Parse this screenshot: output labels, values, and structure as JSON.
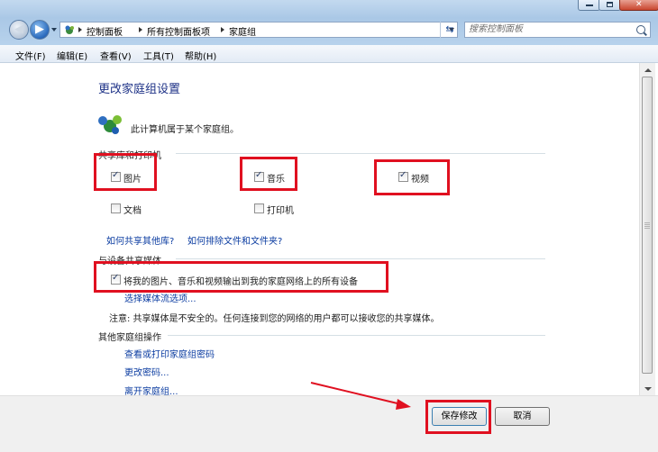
{
  "window": {
    "breadcrumb": [
      "控制面板",
      "所有控制面板项",
      "家庭组"
    ],
    "search_placeholder": "搜索控制面板"
  },
  "menu": [
    "文件(F)",
    "编辑(E)",
    "查看(V)",
    "工具(T)",
    "帮助(H)"
  ],
  "page": {
    "title": "更改家庭组设置",
    "status": "此计算机属于某个家庭组。",
    "share_section": "共享库和打印机",
    "libraries": [
      {
        "label": "图片",
        "checked": true
      },
      {
        "label": "音乐",
        "checked": true
      },
      {
        "label": "视频",
        "checked": true
      },
      {
        "label": "文档",
        "checked": false
      },
      {
        "label": "打印机",
        "checked": false
      }
    ],
    "link_share_other": "如何共享其他库?",
    "link_exclude": "如何排除文件和文件夹?",
    "media_section": "与设备共享媒体",
    "media_option": "将我的图片、音乐和视频输出到我的家庭网络上的所有设备",
    "media_checked": true,
    "link_media_options": "选择媒体流选项...",
    "warning": "注意: 共享媒体是不安全的。任何连接到您的网络的用户都可以接收您的共享媒体。",
    "other_section": "其他家庭组操作",
    "other_links": [
      "查看或打印家庭组密码",
      "更改密码...",
      "离开家庭组..."
    ]
  },
  "buttons": {
    "save": "保存修改",
    "cancel": "取消"
  },
  "colors": {
    "highlight": "#e01020",
    "link": "#0b3ca1",
    "heading": "#1e3287"
  }
}
